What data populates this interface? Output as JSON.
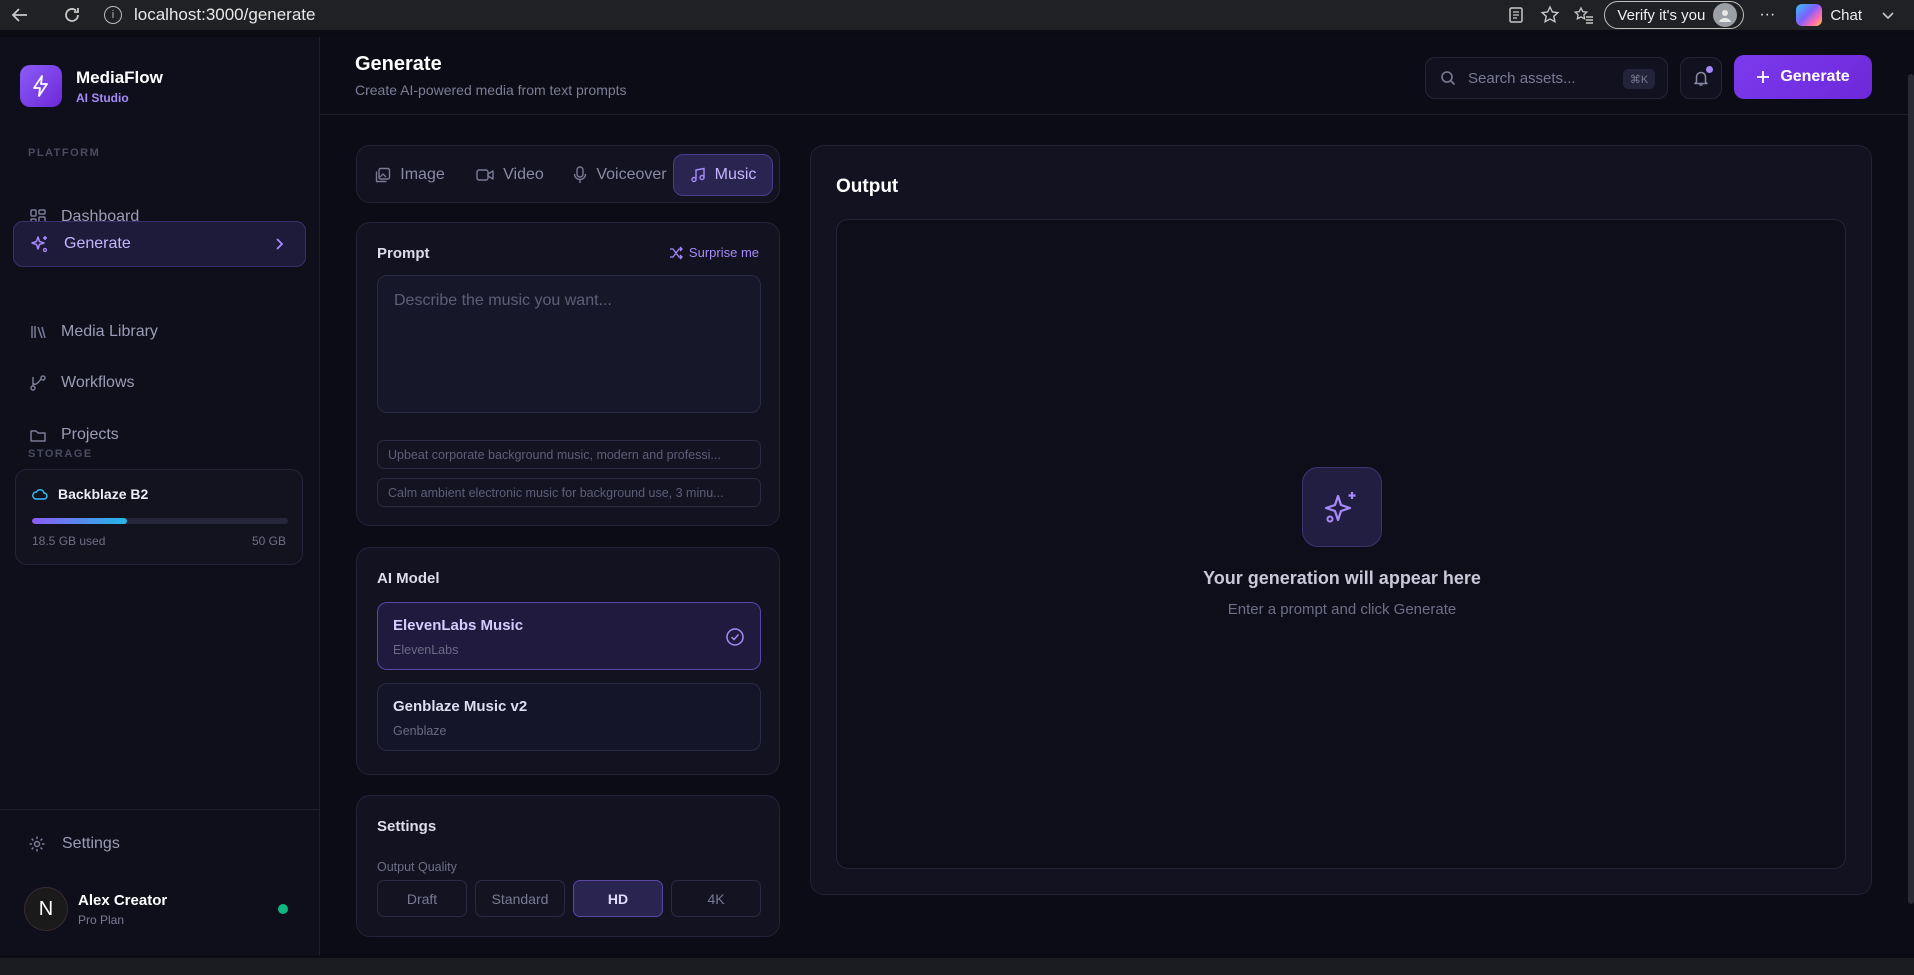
{
  "browser": {
    "url": "localhost:3000/generate",
    "verify_label": "Verify it's you",
    "chat_label": "Chat",
    "menu_glyph": "···"
  },
  "brand": {
    "name": "MediaFlow",
    "subtitle": "AI Studio"
  },
  "sidebar": {
    "platform_label": "PLATFORM",
    "items": [
      {
        "label": "Dashboard",
        "icon": "grid-icon"
      },
      {
        "label": "Generate",
        "icon": "sparkle-icon",
        "active": true
      },
      {
        "label": "Media Library",
        "icon": "library-icon"
      },
      {
        "label": "Workflows",
        "icon": "workflow-icon"
      },
      {
        "label": "Projects",
        "icon": "folder-icon"
      }
    ],
    "storage_label": "STORAGE",
    "storage": {
      "name": "Backblaze B2",
      "used": "18.5 GB used",
      "total": "50 GB",
      "used_fraction": 0.37
    },
    "settings_label": "Settings",
    "user": {
      "initial": "N",
      "name": "Alex Creator",
      "plan": "Pro Plan"
    }
  },
  "header": {
    "title": "Generate",
    "subtitle": "Create AI-powered media from text prompts",
    "search_placeholder": "Search assets...",
    "search_shortcut": "⌘K",
    "generate_label": "Generate"
  },
  "tabs": [
    {
      "label": "Image",
      "icon": "image-icon"
    },
    {
      "label": "Video",
      "icon": "video-icon"
    },
    {
      "label": "Voiceover",
      "icon": "mic-icon"
    },
    {
      "label": "Music",
      "icon": "music-icon",
      "active": true
    }
  ],
  "prompt": {
    "title": "Prompt",
    "surprise_label": "Surprise me",
    "placeholder": "Describe the music you want...",
    "suggestions": [
      "Upbeat corporate background music, modern and professi...",
      "Calm ambient electronic music for background use, 3 minu..."
    ]
  },
  "model": {
    "title": "AI Model",
    "options": [
      {
        "name": "ElevenLabs Music",
        "vendor": "ElevenLabs",
        "selected": true
      },
      {
        "name": "Genblaze Music v2",
        "vendor": "Genblaze",
        "selected": false
      }
    ]
  },
  "settings": {
    "title": "Settings",
    "quality_label": "Output Quality",
    "qualities": [
      "Draft",
      "Standard",
      "HD",
      "4K"
    ],
    "selected_quality": "HD"
  },
  "output": {
    "title": "Output",
    "empty_title": "Your generation will appear here",
    "empty_subtitle": "Enter a prompt and click Generate"
  },
  "colors": {
    "accent": "#7c3aed",
    "accent_light": "#a78bfa",
    "online": "#10b981"
  }
}
